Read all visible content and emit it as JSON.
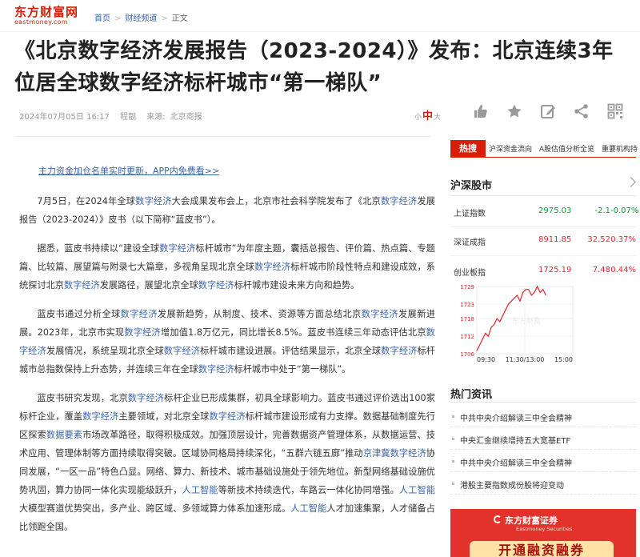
{
  "brand": {
    "name_cn": "东方财富网",
    "name_en": "eastmoney.com"
  },
  "breadcrumb": {
    "home": "首页",
    "channel": "财经频道",
    "current": "正文"
  },
  "article": {
    "title": "《北京数字经济发展报告（2023-2024）》发布：北京连续3年位居全球数字经济标杆城市“第一梯队”",
    "datetime": "2024年07月05日 16:17",
    "author": "程靓",
    "source_label": "来源:",
    "source": "北京商报",
    "promo_link": "主力资金加仓名单实时更新，APP内免费看>>",
    "paragraphs": [
      "7月5日，在2024年全球数字经济大会成果发布会上，北京市社会科学院发布了《北京数字经济发展报告（2023-2024）》皮书（以下简称“蓝皮书”）。",
      "据悉，蓝皮书持续以“建设全球数字经济标杆城市”为年度主题，囊括总报告、评价篇、热点篇、专题篇、比较篇、展望篇与附录七大篇章，多视角呈现北京全球数字经济标杆城市阶段性特点和建设成效，系统探讨北京数字经济发展路径，展望北京全球数字经济标杆城市建设未来方向和趋势。",
      "蓝皮书通过分析全球数字经济发展新趋势，从制度、技术、资源等方面总结北京数字经济发展新进展。2023年，北京市实现数字经济增加值1.8万亿元，同比增长8.5%。蓝皮书连续三年动态评估北京数字经济发展情况，系统呈现北京全球数字经济标杆城市建设进展。评估结果显示，北京全球数字经济标杆城市总指数保持上升态势，并连续三年在全球数字经济标杆城市中处于“第一梯队”。",
      "蓝皮书研究发现，北京数字经济标杆企业已形成集群，初具全球影响力。蓝皮书通过评价选出100家标杆企业，覆盖数字经济主要领域，对北京全球数字经济标杆城市建设形成有力支撑。数据基础制度先行区探索数据要素市场改革路径，取得积极成效。加强顶层设计，完善数据资产管理体系，从数据运营、技术应用、管理体制等方面持续取得突破。区域协同格局持续深化，“五群六链五廊”推动京津冀数字经济协同发展，“一区一品”特色凸显。网络、算力、新技术、城市基础设施处于领先地位。新型网络基础设施优势巩固，算力协同一体化实现能级跃升，人工智能等新技术持续迭代，车路云一体化协同增强。人工智能大模型赛道优势突出，多产业、跨区域、多领域算力体系加速形成。人工智能人才加速集聚，人才储备占比领跑全国。"
    ]
  },
  "font_size": {
    "small": "小",
    "medium": "中",
    "large": "大"
  },
  "hot_search": {
    "tag": "热搜",
    "items": [
      "沪深资金流向",
      "A股估值分析全览",
      "重要机构持"
    ]
  },
  "market": {
    "title": "沪深股市",
    "indices": [
      {
        "name": "上证指数",
        "price": "2975.03",
        "change": "-2.1",
        "pct": "-0.07%",
        "trend": "down"
      },
      {
        "name": "深证成指",
        "price": "8911.85",
        "change": "32.52",
        "pct": "0.37%",
        "trend": "up"
      },
      {
        "name": "创业板指",
        "price": "1725.19",
        "change": "7.48",
        "pct": "0.44%",
        "trend": "up"
      }
    ]
  },
  "chart_data": {
    "type": "line",
    "title": "",
    "watermark": "东方财富",
    "x_ticks": [
      "09:30",
      "11:30/13:00",
      "15:00"
    ],
    "y_ticks": [
      1729,
      1723,
      1718,
      1712,
      1706
    ],
    "ylim": [
      1706,
      1729
    ],
    "grid": true,
    "series": [
      {
        "values": [
          1707,
          1709,
          1711,
          1713,
          1712,
          1715,
          1716,
          1718,
          1717,
          1719,
          1721,
          1723,
          1724,
          1725,
          1726,
          1724,
          1727,
          1728,
          1728,
          1726,
          1727,
          1729,
          1727,
          1728,
          1726
        ]
      }
    ]
  },
  "hot_news": {
    "title": "热门资讯",
    "items": [
      "中共中央介绍解读三中全会精神",
      "中央汇金继续增持五大宽基ETF",
      "中共中央介绍解读三中全会精神",
      "港股主要指数成份股将迎变动"
    ]
  },
  "ad": {
    "brand": "东方财富证券",
    "brand_en": "Eastmoney Securities",
    "slogan": "开通融资融券"
  },
  "colors": {
    "brand_red": "#d81e06",
    "link_blue": "#3a63a8",
    "up": "#e0272b",
    "down": "#0a9b35"
  }
}
